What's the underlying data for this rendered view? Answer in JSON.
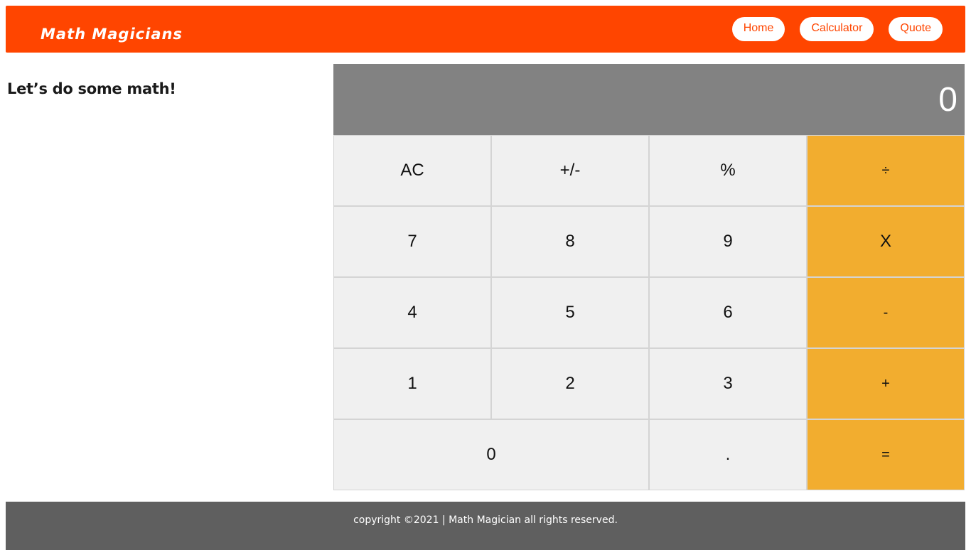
{
  "nav": {
    "brand": "Math Magicians",
    "links": [
      "Home",
      "Calculator",
      "Quote"
    ]
  },
  "intro": {
    "title": "Let’s do some math!"
  },
  "calculator": {
    "display": "0",
    "keys": [
      "AC",
      "+/-",
      "%",
      "÷",
      "7",
      "8",
      "9",
      "X",
      "4",
      "5",
      "6",
      "-",
      "1",
      "2",
      "3",
      "+",
      "0",
      ".",
      "="
    ]
  },
  "footer": {
    "text": "copyright ©2021 | Math Magician all rights reserved."
  },
  "colors": {
    "navbar": "#ff4500",
    "display": "#828282",
    "operator_key": "#f2ad2f",
    "digit_key": "#f0f0f0",
    "footer": "#5f5f5f"
  }
}
